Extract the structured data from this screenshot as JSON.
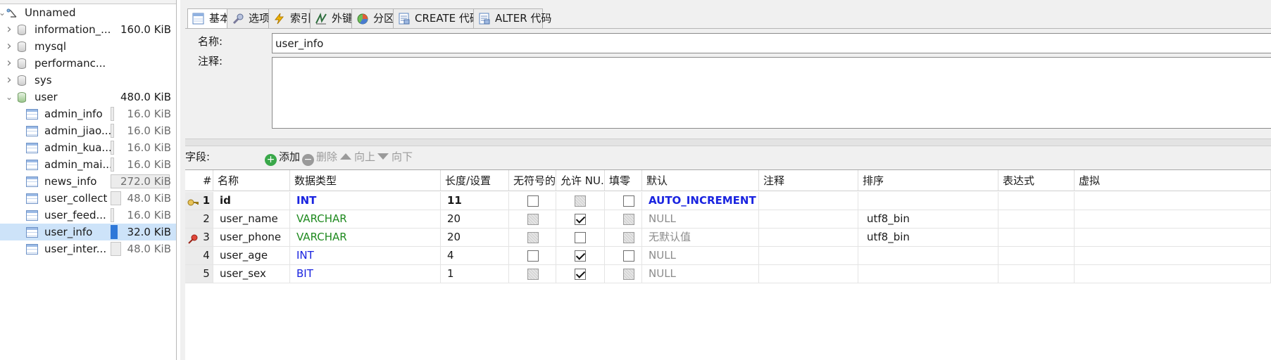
{
  "tree": {
    "root_label": "Unnamed",
    "databases": [
      {
        "name": "information_...",
        "size": "160.0 KiB",
        "expanded": false
      },
      {
        "name": "mysql",
        "size": "",
        "expanded": false
      },
      {
        "name": "performanc...",
        "size": "",
        "expanded": false
      },
      {
        "name": "sys",
        "size": "",
        "expanded": false
      },
      {
        "name": "user",
        "size": "480.0 KiB",
        "expanded": true
      }
    ],
    "tables": [
      {
        "name": "admin_info",
        "size": "16.0 KiB",
        "bar_pct": 0.06
      },
      {
        "name": "admin_jiao...",
        "size": "16.0 KiB",
        "bar_pct": 0.06
      },
      {
        "name": "admin_kua...",
        "size": "16.0 KiB",
        "bar_pct": 0.06
      },
      {
        "name": "admin_mai...",
        "size": "16.0 KiB",
        "bar_pct": 0.06
      },
      {
        "name": "news_info",
        "size": "272.0 KiB",
        "bar_pct": 1.0
      },
      {
        "name": "user_collect",
        "size": "48.0 KiB",
        "bar_pct": 0.18
      },
      {
        "name": "user_feed...",
        "size": "16.0 KiB",
        "bar_pct": 0.06
      },
      {
        "name": "user_info",
        "size": "32.0 KiB",
        "bar_pct": 0.12,
        "selected": true
      },
      {
        "name": "user_inter...",
        "size": "48.0 KiB",
        "bar_pct": 0.18
      }
    ]
  },
  "tabs": [
    {
      "label": "基本",
      "icon": "table-icon",
      "active": true
    },
    {
      "label": "选项",
      "icon": "wrench-icon"
    },
    {
      "label": "索引",
      "icon": "lightning-icon"
    },
    {
      "label": "外键",
      "icon": "foreign-key-icon"
    },
    {
      "label": "分区",
      "icon": "partition-icon"
    },
    {
      "label": "CREATE 代码",
      "icon": "code-icon"
    },
    {
      "label": "ALTER 代码",
      "icon": "code-icon"
    }
  ],
  "form": {
    "name_label": "名称:",
    "name_value": "user_info",
    "comment_label": "注释:",
    "comment_value": ""
  },
  "fields_toolbar": {
    "label": "字段:",
    "add": "添加",
    "delete": "删除",
    "up": "向上",
    "down": "向下"
  },
  "columns": [
    "#",
    "名称",
    "数据类型",
    "长度/设置",
    "无符号的",
    "允许 NU...",
    "填零",
    "默认",
    "注释",
    "排序",
    "表达式",
    "虚拟"
  ],
  "rows": [
    {
      "num": "1",
      "key": "primary-key-icon",
      "name": "id",
      "type": "INT",
      "length": "11",
      "unsigned": false,
      "unsigned_disabled": false,
      "allow_null": false,
      "allow_null_disabled": true,
      "zerofill": false,
      "zerofill_disabled": false,
      "default": "AUTO_INCREMENT",
      "default_style": "auto",
      "comment": "",
      "collation": "",
      "bold": true
    },
    {
      "num": "2",
      "key": "",
      "name": "user_name",
      "type": "VARCHAR",
      "length": "20",
      "unsigned": false,
      "unsigned_disabled": true,
      "allow_null": true,
      "allow_null_disabled": false,
      "zerofill": false,
      "zerofill_disabled": true,
      "default": "NULL",
      "default_style": "null",
      "comment": "",
      "collation": "utf8_bin"
    },
    {
      "num": "3",
      "key": "unique-key-icon",
      "name": "user_phone",
      "type": "VARCHAR",
      "length": "20",
      "unsigned": false,
      "unsigned_disabled": true,
      "allow_null": false,
      "allow_null_disabled": false,
      "zerofill": false,
      "zerofill_disabled": true,
      "default": "无默认值",
      "default_style": "null",
      "comment": "",
      "collation": "utf8_bin"
    },
    {
      "num": "4",
      "key": "",
      "name": "user_age",
      "type": "INT",
      "length": "4",
      "unsigned": false,
      "unsigned_disabled": false,
      "allow_null": true,
      "allow_null_disabled": false,
      "zerofill": false,
      "zerofill_disabled": false,
      "default": "NULL",
      "default_style": "null",
      "comment": "",
      "collation": ""
    },
    {
      "num": "5",
      "key": "",
      "name": "user_sex",
      "type": "BIT",
      "length": "1",
      "unsigned": false,
      "unsigned_disabled": true,
      "allow_null": true,
      "allow_null_disabled": false,
      "zerofill": false,
      "zerofill_disabled": true,
      "default": "NULL",
      "default_style": "null",
      "comment": "",
      "collation": ""
    }
  ],
  "colors": {
    "int_type": "#1a24e0",
    "varchar_type": "#1f8a1f",
    "selection": "#cde3f9",
    "size_bar_selected": "#2f78d8"
  }
}
